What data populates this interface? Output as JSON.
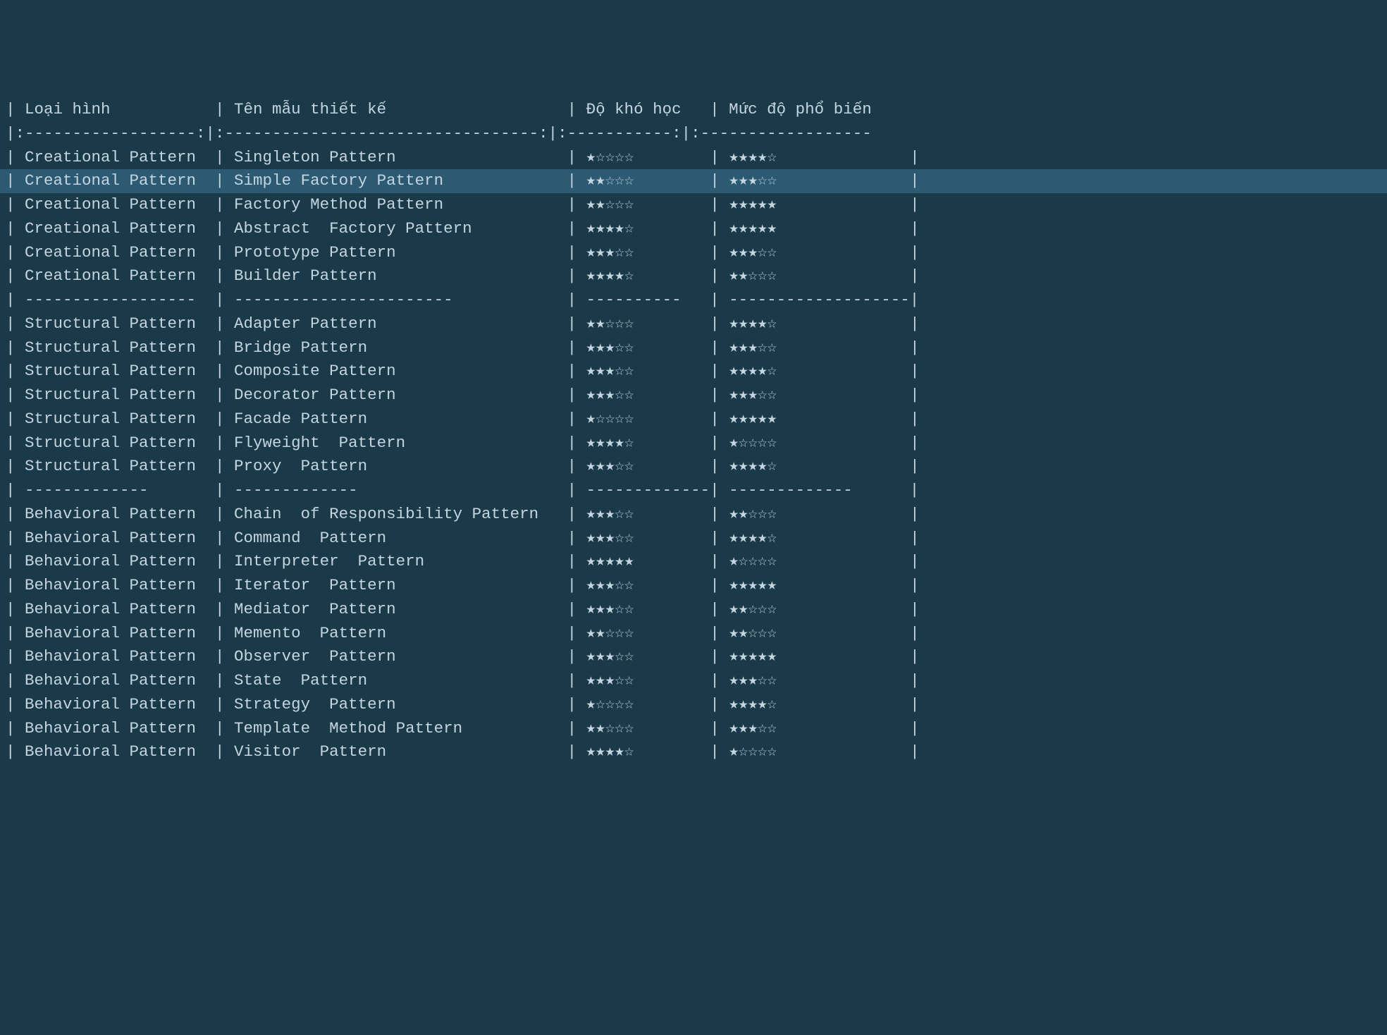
{
  "headers": {
    "col1": "Loại hình",
    "col2": "Tên mẫu thiết kế",
    "col3": "Độ khó học",
    "col4": "Mức độ phổ biến"
  },
  "headerSepRow": "|:------------------:|:---------------------------------:|:-----------:|:------------------",
  "rows": [
    {
      "type": "data",
      "c1": "Creational Pattern",
      "c2": "Singleton Pattern",
      "diff": 1,
      "pop": 4,
      "highlight": false
    },
    {
      "type": "data",
      "c1": "Creational Pattern",
      "c2": "Simple Factory Pattern",
      "diff": 2,
      "pop": 3,
      "highlight": true
    },
    {
      "type": "data",
      "c1": "Creational Pattern",
      "c2": "Factory Method Pattern",
      "diff": 2,
      "pop": 5,
      "highlight": false
    },
    {
      "type": "data",
      "c1": "Creational Pattern",
      "c2": "Abstract  Factory Pattern",
      "diff": 4,
      "pop": 5,
      "highlight": false
    },
    {
      "type": "data",
      "c1": "Creational Pattern",
      "c2": "Prototype Pattern",
      "diff": 3,
      "pop": 3,
      "highlight": false
    },
    {
      "type": "data",
      "c1": "Creational Pattern",
      "c2": "Builder Pattern",
      "diff": 4,
      "pop": 2,
      "highlight": false
    },
    {
      "type": "sep",
      "c1": "------------------",
      "c2": "-----------------------",
      "c3": "----------",
      "c4": "-------------------",
      "highlight": false
    },
    {
      "type": "data",
      "c1": "Structural Pattern",
      "c2": "Adapter Pattern",
      "diff": 2,
      "pop": 4,
      "highlight": false
    },
    {
      "type": "data",
      "c1": "Structural Pattern",
      "c2": "Bridge Pattern",
      "diff": 3,
      "pop": 3,
      "highlight": false
    },
    {
      "type": "data",
      "c1": "Structural Pattern",
      "c2": "Composite Pattern",
      "diff": 3,
      "pop": 4,
      "highlight": false
    },
    {
      "type": "data",
      "c1": "Structural Pattern",
      "c2": "Decorator Pattern",
      "diff": 3,
      "pop": 3,
      "highlight": false
    },
    {
      "type": "data",
      "c1": "Structural Pattern",
      "c2": "Facade Pattern",
      "diff": 1,
      "pop": 5,
      "highlight": false
    },
    {
      "type": "data",
      "c1": "Structural Pattern",
      "c2": "Flyweight  Pattern",
      "diff": 4,
      "pop": 1,
      "highlight": false
    },
    {
      "type": "data",
      "c1": "Structural Pattern",
      "c2": "Proxy  Pattern",
      "diff": 3,
      "pop": 4,
      "highlight": false
    },
    {
      "type": "sep",
      "c1": "-------------",
      "c2": "-------------",
      "c3": "-------------",
      "c4": "-------------",
      "highlight": false
    },
    {
      "type": "data",
      "c1": "Behavioral Pattern",
      "c2": "Chain  of Responsibility Pattern",
      "diff": 3,
      "pop": 2,
      "highlight": false
    },
    {
      "type": "data",
      "c1": "Behavioral Pattern",
      "c2": "Command  Pattern",
      "diff": 3,
      "pop": 4,
      "highlight": false
    },
    {
      "type": "data",
      "c1": "Behavioral Pattern",
      "c2": "Interpreter  Pattern",
      "diff": 5,
      "pop": 1,
      "highlight": false
    },
    {
      "type": "data",
      "c1": "Behavioral Pattern",
      "c2": "Iterator  Pattern",
      "diff": 3,
      "pop": 5,
      "highlight": false
    },
    {
      "type": "data",
      "c1": "Behavioral Pattern",
      "c2": "Mediator  Pattern",
      "diff": 3,
      "pop": 2,
      "highlight": false
    },
    {
      "type": "data",
      "c1": "Behavioral Pattern",
      "c2": "Memento  Pattern",
      "diff": 2,
      "pop": 2,
      "highlight": false
    },
    {
      "type": "data",
      "c1": "Behavioral Pattern",
      "c2": "Observer  Pattern",
      "diff": 3,
      "pop": 5,
      "highlight": false
    },
    {
      "type": "data",
      "c1": "Behavioral Pattern",
      "c2": "State  Pattern",
      "diff": 3,
      "pop": 3,
      "highlight": false
    },
    {
      "type": "data",
      "c1": "Behavioral Pattern",
      "c2": "Strategy  Pattern",
      "diff": 1,
      "pop": 4,
      "highlight": false
    },
    {
      "type": "data",
      "c1": "Behavioral Pattern",
      "c2": "Template  Method Pattern",
      "diff": 2,
      "pop": 3,
      "highlight": false
    },
    {
      "type": "data",
      "c1": "Behavioral Pattern",
      "c2": "Visitor  Pattern",
      "diff": 4,
      "pop": 1,
      "highlight": false
    }
  ],
  "colWidths": {
    "c1": 20,
    "c2": 35,
    "c3": 13,
    "c4": 19
  },
  "stars": {
    "filled": "★",
    "empty": "☆"
  }
}
